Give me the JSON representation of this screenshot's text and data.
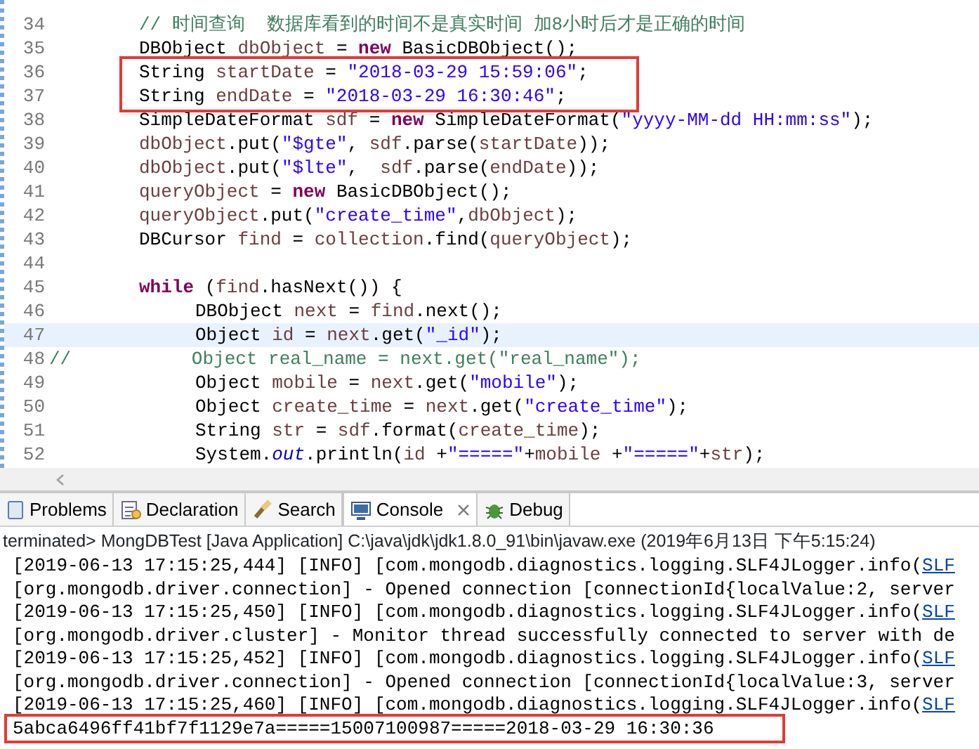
{
  "editor": {
    "lines": [
      {
        "number": "34",
        "kind": "code",
        "current": false,
        "framed": false,
        "tokens": [
          {
            "kind": "comment",
            "text": "// 时间查询  数据库看到的时间不是真实时间 加8小时后才是正确的时间"
          }
        ]
      },
      {
        "number": "35",
        "kind": "code",
        "current": false,
        "framed": false,
        "tokens": [
          {
            "kind": "plain",
            "text": "DBObject "
          },
          {
            "kind": "var",
            "text": "dbObject"
          },
          {
            "kind": "plain",
            "text": " = "
          },
          {
            "kind": "keyword",
            "text": "new"
          },
          {
            "kind": "plain",
            "text": " BasicDBObject();"
          }
        ]
      },
      {
        "number": "36",
        "kind": "code",
        "current": false,
        "framed": true,
        "tokens": [
          {
            "kind": "plain",
            "text": "String "
          },
          {
            "kind": "var",
            "text": "startDate"
          },
          {
            "kind": "plain",
            "text": " = "
          },
          {
            "kind": "string",
            "text": "\"2018-03-29 15:59:06\""
          },
          {
            "kind": "plain",
            "text": ";"
          }
        ]
      },
      {
        "number": "37",
        "kind": "code",
        "current": false,
        "framed": true,
        "tokens": [
          {
            "kind": "plain",
            "text": "String "
          },
          {
            "kind": "var",
            "text": "endDate"
          },
          {
            "kind": "plain",
            "text": " = "
          },
          {
            "kind": "string",
            "text": "\"2018-03-29 16:30:46\""
          },
          {
            "kind": "plain",
            "text": ";"
          }
        ]
      },
      {
        "number": "38",
        "kind": "code",
        "current": false,
        "framed": false,
        "tokens": [
          {
            "kind": "plain",
            "text": "SimpleDateFormat "
          },
          {
            "kind": "var",
            "text": "sdf"
          },
          {
            "kind": "plain",
            "text": " = "
          },
          {
            "kind": "keyword",
            "text": "new"
          },
          {
            "kind": "plain",
            "text": " SimpleDateFormat("
          },
          {
            "kind": "string",
            "text": "\"yyyy-MM-dd HH:mm:ss\""
          },
          {
            "kind": "plain",
            "text": ");"
          }
        ]
      },
      {
        "number": "39",
        "kind": "code",
        "current": false,
        "framed": false,
        "tokens": [
          {
            "kind": "var",
            "text": "dbObject"
          },
          {
            "kind": "plain",
            "text": ".put("
          },
          {
            "kind": "string",
            "text": "\"$gte\""
          },
          {
            "kind": "plain",
            "text": ", "
          },
          {
            "kind": "var",
            "text": "sdf"
          },
          {
            "kind": "plain",
            "text": ".parse("
          },
          {
            "kind": "var",
            "text": "startDate"
          },
          {
            "kind": "plain",
            "text": "));"
          }
        ]
      },
      {
        "number": "40",
        "kind": "code",
        "current": false,
        "framed": false,
        "tokens": [
          {
            "kind": "var",
            "text": "dbObject"
          },
          {
            "kind": "plain",
            "text": ".put("
          },
          {
            "kind": "string",
            "text": "\"$lte\""
          },
          {
            "kind": "plain",
            "text": ",  "
          },
          {
            "kind": "var",
            "text": "sdf"
          },
          {
            "kind": "plain",
            "text": ".parse("
          },
          {
            "kind": "var",
            "text": "endDate"
          },
          {
            "kind": "plain",
            "text": "));"
          }
        ]
      },
      {
        "number": "41",
        "kind": "code",
        "current": false,
        "framed": false,
        "tokens": [
          {
            "kind": "var",
            "text": "queryObject"
          },
          {
            "kind": "plain",
            "text": " = "
          },
          {
            "kind": "keyword",
            "text": "new"
          },
          {
            "kind": "plain",
            "text": " BasicDBObject();"
          }
        ]
      },
      {
        "number": "42",
        "kind": "code",
        "current": false,
        "framed": false,
        "tokens": [
          {
            "kind": "var",
            "text": "queryObject"
          },
          {
            "kind": "plain",
            "text": ".put("
          },
          {
            "kind": "string",
            "text": "\"create_time\""
          },
          {
            "kind": "plain",
            "text": ","
          },
          {
            "kind": "var",
            "text": "dbObject"
          },
          {
            "kind": "plain",
            "text": ");"
          }
        ]
      },
      {
        "number": "43",
        "kind": "code",
        "current": false,
        "framed": false,
        "tokens": [
          {
            "kind": "plain",
            "text": "DBCursor "
          },
          {
            "kind": "var",
            "text": "find"
          },
          {
            "kind": "plain",
            "text": " = "
          },
          {
            "kind": "var",
            "text": "collection"
          },
          {
            "kind": "plain",
            "text": ".find("
          },
          {
            "kind": "var",
            "text": "queryObject"
          },
          {
            "kind": "plain",
            "text": ");"
          }
        ]
      },
      {
        "number": "44",
        "current": false,
        "framed": false
      },
      {
        "number": "45",
        "kind": "code",
        "current": false,
        "framed": false,
        "tokens": [
          {
            "kind": "keyword",
            "text": "while"
          },
          {
            "kind": "plain",
            "text": " ("
          },
          {
            "kind": "var",
            "text": "find"
          },
          {
            "kind": "plain",
            "text": ".hasNext()) {"
          }
        ],
        "children": [
          {
            "number": "46",
            "kind": "code",
            "current": false,
            "framed": false,
            "tokens": [
              {
                "kind": "plain",
                "text": "DBObject "
              },
              {
                "kind": "var",
                "text": "next"
              },
              {
                "kind": "plain",
                "text": " = "
              },
              {
                "kind": "var",
                "text": "find"
              },
              {
                "kind": "plain",
                "text": ".next();"
              }
            ]
          },
          {
            "number": "47",
            "kind": "code",
            "current": true,
            "framed": false,
            "tokens": [
              {
                "kind": "plain",
                "text": "Object "
              },
              {
                "kind": "var",
                "text": "id"
              },
              {
                "kind": "plain",
                "text": " = "
              },
              {
                "kind": "var",
                "text": "next"
              },
              {
                "kind": "plain",
                "text": ".get("
              },
              {
                "kind": "string",
                "text": "\"_id\""
              },
              {
                "kind": "plain",
                "text": ");"
              }
            ]
          },
          {
            "number": "48",
            "kind": "commented",
            "current": false,
            "framed": false,
            "tokens": [
              {
                "kind": "comment",
                "text": "//           Object real_name = next.get(\"real_name\");"
              }
            ]
          },
          {
            "number": "49",
            "kind": "code",
            "current": false,
            "framed": false,
            "tokens": [
              {
                "kind": "plain",
                "text": "Object "
              },
              {
                "kind": "var",
                "text": "mobile"
              },
              {
                "kind": "plain",
                "text": " = "
              },
              {
                "kind": "var",
                "text": "next"
              },
              {
                "kind": "plain",
                "text": ".get("
              },
              {
                "kind": "string",
                "text": "\"mobile\""
              },
              {
                "kind": "plain",
                "text": ");"
              }
            ]
          },
          {
            "number": "50",
            "kind": "code",
            "current": false,
            "framed": false,
            "tokens": [
              {
                "kind": "plain",
                "text": "Object "
              },
              {
                "kind": "var",
                "text": "create_time"
              },
              {
                "kind": "plain",
                "text": " = "
              },
              {
                "kind": "var",
                "text": "next"
              },
              {
                "kind": "plain",
                "text": ".get("
              },
              {
                "kind": "string",
                "text": "\"create_time\""
              },
              {
                "kind": "plain",
                "text": ");"
              }
            ]
          },
          {
            "number": "51",
            "kind": "code",
            "current": false,
            "framed": false,
            "tokens": [
              {
                "kind": "plain",
                "text": "String "
              },
              {
                "kind": "var",
                "text": "str"
              },
              {
                "kind": "plain",
                "text": " = "
              },
              {
                "kind": "var",
                "text": "sdf"
              },
              {
                "kind": "plain",
                "text": ".format("
              },
              {
                "kind": "var",
                "text": "create_time"
              },
              {
                "kind": "plain",
                "text": ");"
              }
            ]
          },
          {
            "number": "52",
            "kind": "code",
            "current": false,
            "framed": false,
            "tokens": [
              {
                "kind": "plain",
                "text": "System."
              },
              {
                "kind": "field",
                "text": "out"
              },
              {
                "kind": "plain",
                "text": ".println("
              },
              {
                "kind": "var",
                "text": "id"
              },
              {
                "kind": "plain",
                "text": " +"
              },
              {
                "kind": "string",
                "text": "\"=====\""
              },
              {
                "kind": "plain",
                "text": "+"
              },
              {
                "kind": "var",
                "text": "mobile"
              },
              {
                "kind": "plain",
                "text": " +"
              },
              {
                "kind": "string",
                "text": "\"=====\""
              },
              {
                "kind": "plain",
                "text": "+"
              },
              {
                "kind": "var",
                "text": "str"
              },
              {
                "kind": "plain",
                "text": ");"
              }
            ]
          }
        ]
      }
    ]
  },
  "tabs": [
    {
      "label": "Problems",
      "kind": "problems",
      "selected": false,
      "closable": false
    },
    {
      "label": "Declaration",
      "kind": "declaration",
      "selected": false,
      "closable": false
    },
    {
      "label": "Search",
      "kind": "search",
      "selected": false,
      "closable": false
    },
    {
      "label": "Console",
      "kind": "console",
      "selected": true,
      "closable": true
    },
    {
      "label": "Debug",
      "kind": "debug",
      "selected": false,
      "closable": false
    }
  ],
  "console": {
    "header": "terminated> MongDBTest [Java Application] C:\\java\\jdk\\jdk1.8.0_91\\bin\\javaw.exe (2019年6月13日 下午5:15:24)",
    "lines": [
      {
        "text": "[2019-06-13 17:15:25,444] [INFO] [com.mongodb.diagnostics.logging.SLF4JLogger.info(",
        "link": "SLF",
        "framed": false
      },
      {
        "text": "[org.mongodb.driver.connection] - Opened connection [connectionId{localValue:2, server",
        "framed": false
      },
      {
        "text": "[2019-06-13 17:15:25,450] [INFO] [com.mongodb.diagnostics.logging.SLF4JLogger.info(",
        "link": "SLF",
        "framed": false
      },
      {
        "text": "[org.mongodb.driver.cluster] - Monitor thread successfully connected to server with de",
        "framed": false
      },
      {
        "text": "[2019-06-13 17:15:25,452] [INFO] [com.mongodb.diagnostics.logging.SLF4JLogger.info(",
        "link": "SLF",
        "framed": false
      },
      {
        "text": "[org.mongodb.driver.connection] - Opened connection [connectionId{localValue:3, server",
        "framed": false
      },
      {
        "text": "[2019-06-13 17:15:25,460] [INFO] [com.mongodb.diagnostics.logging.SLF4JLogger.info(",
        "link": "SLF",
        "framed": false
      },
      {
        "text": "5abca6496ff41bf7f1129e7a=====15007100987=====2018-03-29 16:30:36",
        "framed": true
      }
    ]
  }
}
